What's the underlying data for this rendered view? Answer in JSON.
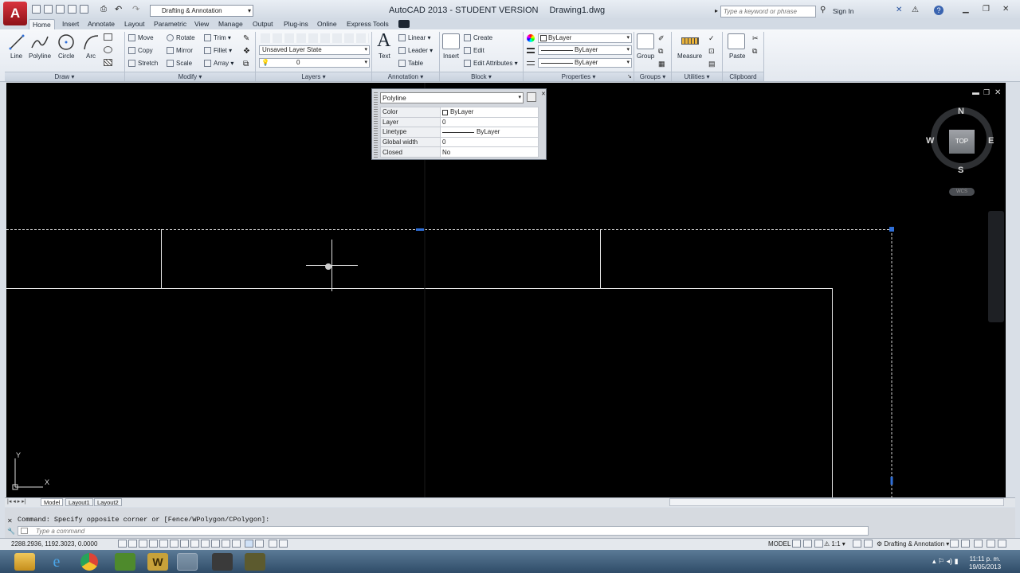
{
  "app": {
    "logo_letter": "A",
    "title": "AutoCAD 2013 - STUDENT VERSION",
    "document": "Drawing1.dwg",
    "workspace": "Drafting & Annotation",
    "search_placeholder": "Type a keyword or phrase",
    "signin": "Sign In"
  },
  "tabs": [
    {
      "label": "Home",
      "active": true
    },
    {
      "label": "Insert"
    },
    {
      "label": "Annotate"
    },
    {
      "label": "Layout"
    },
    {
      "label": "Parametric"
    },
    {
      "label": "View"
    },
    {
      "label": "Manage"
    },
    {
      "label": "Output"
    },
    {
      "label": "Plug-ins"
    },
    {
      "label": "Online"
    },
    {
      "label": "Express Tools"
    }
  ],
  "ribbon": {
    "draw": {
      "title": "Draw",
      "line": "Line",
      "polyline": "Polyline",
      "circle": "Circle",
      "arc": "Arc"
    },
    "modify": {
      "title": "Modify",
      "move": "Move",
      "rotate": "Rotate",
      "trim": "Trim",
      "copy": "Copy",
      "mirror": "Mirror",
      "fillet": "Fillet",
      "stretch": "Stretch",
      "scale": "Scale",
      "array": "Array"
    },
    "layers": {
      "title": "Layers",
      "layer_state": "Unsaved Layer State",
      "current_layer": "0"
    },
    "annotation": {
      "title": "Annotation",
      "text": "Text",
      "linear": "Linear",
      "leader": "Leader",
      "table": "Table"
    },
    "block": {
      "title": "Block",
      "insert": "Insert",
      "create": "Create",
      "edit": "Edit",
      "edit_attributes": "Edit Attributes"
    },
    "properties": {
      "title": "Properties",
      "color": "ByLayer",
      "lineweight": "ByLayer",
      "linetype": "ByLayer"
    },
    "groups": {
      "title": "Groups",
      "group": "Group"
    },
    "utilities": {
      "title": "Utilities",
      "measure": "Measure"
    },
    "clipboard": {
      "title": "Clipboard",
      "paste": "Paste"
    }
  },
  "properties_palette": {
    "object_type": "Polyline",
    "rows": [
      {
        "key": "Color",
        "value": "ByLayer"
      },
      {
        "key": "Layer",
        "value": "0"
      },
      {
        "key": "Linetype",
        "value": "ByLayer"
      },
      {
        "key": "Global width",
        "value": "0"
      },
      {
        "key": "Closed",
        "value": "No"
      }
    ]
  },
  "viewcube": {
    "n": "N",
    "s": "S",
    "e": "E",
    "w": "W",
    "face": "TOP",
    "wcs": "WCS"
  },
  "ucs": {
    "x": "X",
    "y": "Y"
  },
  "layout_tabs": [
    "Model",
    "Layout1",
    "Layout2"
  ],
  "command": {
    "history": "Command: Specify opposite corner or [Fence/WPolygon/CPolygon]:",
    "placeholder": "Type a command"
  },
  "status": {
    "coords": "2288.2936, 1192.3023, 0.0000",
    "model": "MODEL",
    "scale": "1:1",
    "workspace": "Drafting & Annotation"
  },
  "clock": {
    "time": "11:11 p. m.",
    "date": "19/05/2013"
  },
  "colors": {
    "canvas": "#000000",
    "grip": "#2f6fd8",
    "accent": "#c41e24"
  }
}
